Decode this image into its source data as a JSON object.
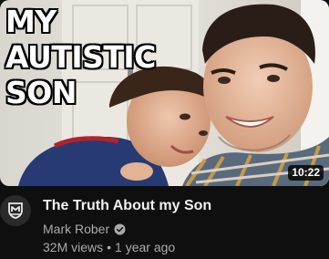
{
  "thumbnail": {
    "overlay_lines": [
      "MY",
      "AUTISTIC",
      "SON"
    ],
    "duration": "10:22"
  },
  "video": {
    "title": "The Truth About my Son",
    "channel": "Mark Rober",
    "views": "32M views",
    "separator": "•",
    "age": "1 year ago"
  },
  "icons": {
    "avatar": "mark-rober-logo-icon",
    "verified": "verified-check-icon"
  },
  "colors": {
    "background": "#0f0f0f",
    "primary_text": "#f1f1f1",
    "secondary_text": "#aaaaaa"
  }
}
